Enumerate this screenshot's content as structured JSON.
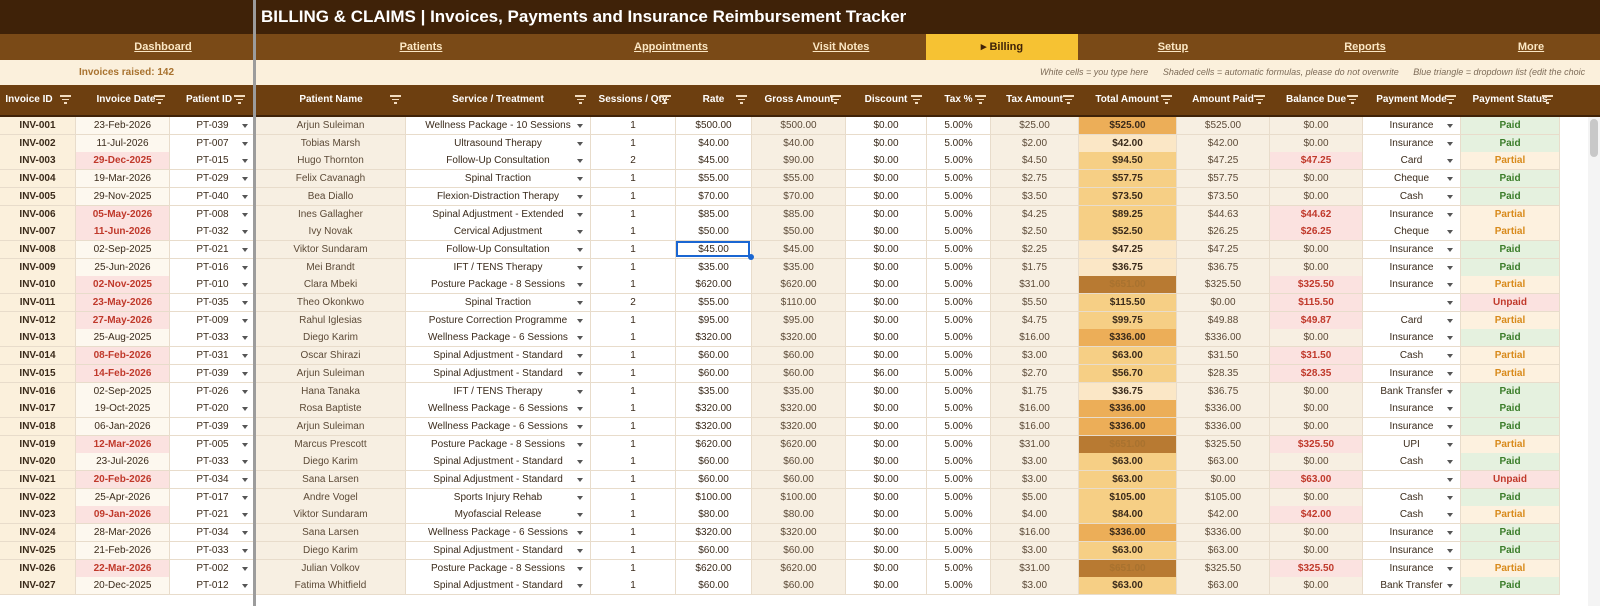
{
  "app": {
    "title": "BILLING & CLAIMS  |  Invoices, Payments and Insurance Reimbursement Tracker"
  },
  "nav": [
    {
      "label": "Dashboard"
    },
    {
      "label": "Patients"
    },
    {
      "label": "Appointments"
    },
    {
      "label": "Visit Notes"
    },
    {
      "label": "▸ Billing",
      "active": true
    },
    {
      "label": "Setup"
    },
    {
      "label": "Reports"
    },
    {
      "label": "More"
    }
  ],
  "info": {
    "invoices_raised": "Invoices raised: 142",
    "legend_white": "White cells = you type here",
    "legend_shaded": "Shaded cells = automatic formulas, please do not overwrite",
    "legend_blue": "Blue triangle = dropdown list (edit the choic"
  },
  "columns": [
    "Invoice ID",
    "Invoice Date",
    "Patient ID",
    "Patient Name",
    "Service / Treatment",
    "Sessions / Qty",
    "Rate",
    "Gross Amount",
    "Discount",
    "Tax %",
    "Tax Amount",
    "Total Amount",
    "Amount Paid",
    "Balance Due",
    "Payment Mode",
    "Payment Status"
  ],
  "colors": {
    "title_bg": "#3f2208",
    "nav_bg": "#7a4a17",
    "nav_active": "#f6c233",
    "header_bg": "#6d3f10",
    "paid": "#3b7d2a",
    "partial": "#d88a1b",
    "unpaid": "#c0392b",
    "selection": "#1a66d2"
  },
  "rows": [
    [
      "INV-001",
      "23-Feb-2026",
      "PT-039",
      "Arjun Suleiman",
      "Wellness Package - 10 Sessions",
      "1",
      "$500.00",
      "$500.00",
      "$0.00",
      "5.00%",
      "$25.00",
      "$525.00",
      "$525.00",
      "$0.00",
      "Insurance",
      "Paid"
    ],
    [
      "INV-002",
      "11-Jul-2026",
      "PT-007",
      "Tobias Marsh",
      "Ultrasound Therapy",
      "1",
      "$40.00",
      "$40.00",
      "$0.00",
      "5.00%",
      "$2.00",
      "$42.00",
      "$42.00",
      "$0.00",
      "Insurance",
      "Paid"
    ],
    [
      "INV-003",
      "29-Dec-2025",
      "PT-015",
      "Hugo Thornton",
      "Follow-Up Consultation",
      "2",
      "$45.00",
      "$90.00",
      "$0.00",
      "5.00%",
      "$4.50",
      "$94.50",
      "$47.25",
      "$47.25",
      "Card",
      "Partial"
    ],
    [
      "INV-004",
      "19-Mar-2026",
      "PT-029",
      "Felix Cavanagh",
      "Spinal Traction",
      "1",
      "$55.00",
      "$55.00",
      "$0.00",
      "5.00%",
      "$2.75",
      "$57.75",
      "$57.75",
      "$0.00",
      "Cheque",
      "Paid"
    ],
    [
      "INV-005",
      "29-Nov-2025",
      "PT-040",
      "Bea Diallo",
      "Flexion-Distraction Therapy",
      "1",
      "$70.00",
      "$70.00",
      "$0.00",
      "5.00%",
      "$3.50",
      "$73.50",
      "$73.50",
      "$0.00",
      "Cash",
      "Paid"
    ],
    [
      "INV-006",
      "05-May-2026",
      "PT-008",
      "Ines Gallagher",
      "Spinal Adjustment - Extended",
      "1",
      "$85.00",
      "$85.00",
      "$0.00",
      "5.00%",
      "$4.25",
      "$89.25",
      "$44.63",
      "$44.62",
      "Insurance",
      "Partial"
    ],
    [
      "INV-007",
      "11-Jun-2026",
      "PT-032",
      "Ivy Novak",
      "Cervical Adjustment",
      "1",
      "$50.00",
      "$50.00",
      "$0.00",
      "5.00%",
      "$2.50",
      "$52.50",
      "$26.25",
      "$26.25",
      "Cheque",
      "Partial"
    ],
    [
      "INV-008",
      "02-Sep-2025",
      "PT-021",
      "Viktor Sundaram",
      "Follow-Up Consultation",
      "1",
      "$45.00",
      "$45.00",
      "$0.00",
      "5.00%",
      "$2.25",
      "$47.25",
      "$47.25",
      "$0.00",
      "Insurance",
      "Paid"
    ],
    [
      "INV-009",
      "25-Jun-2026",
      "PT-016",
      "Mei Brandt",
      "IFT / TENS Therapy",
      "1",
      "$35.00",
      "$35.00",
      "$0.00",
      "5.00%",
      "$1.75",
      "$36.75",
      "$36.75",
      "$0.00",
      "Insurance",
      "Paid"
    ],
    [
      "INV-010",
      "02-Nov-2025",
      "PT-010",
      "Clara Mbeki",
      "Posture Package - 8 Sessions",
      "1",
      "$620.00",
      "$620.00",
      "$0.00",
      "5.00%",
      "$31.00",
      "$651.00",
      "$325.50",
      "$325.50",
      "Insurance",
      "Partial"
    ],
    [
      "INV-011",
      "23-May-2026",
      "PT-035",
      "Theo Okonkwo",
      "Spinal Traction",
      "2",
      "$55.00",
      "$110.00",
      "$0.00",
      "5.00%",
      "$5.50",
      "$115.50",
      "$0.00",
      "$115.50",
      "",
      "Unpaid"
    ],
    [
      "INV-012",
      "27-May-2026",
      "PT-009",
      "Rahul Iglesias",
      "Posture Correction Programme",
      "1",
      "$95.00",
      "$95.00",
      "$0.00",
      "5.00%",
      "$4.75",
      "$99.75",
      "$49.88",
      "$49.87",
      "Card",
      "Partial"
    ],
    [
      "INV-013",
      "25-Aug-2025",
      "PT-033",
      "Diego Karim",
      "Wellness Package - 6 Sessions",
      "1",
      "$320.00",
      "$320.00",
      "$0.00",
      "5.00%",
      "$16.00",
      "$336.00",
      "$336.00",
      "$0.00",
      "Insurance",
      "Paid"
    ],
    [
      "INV-014",
      "08-Feb-2026",
      "PT-031",
      "Oscar Shirazi",
      "Spinal Adjustment - Standard",
      "1",
      "$60.00",
      "$60.00",
      "$0.00",
      "5.00%",
      "$3.00",
      "$63.00",
      "$31.50",
      "$31.50",
      "Cash",
      "Partial"
    ],
    [
      "INV-015",
      "14-Feb-2026",
      "PT-039",
      "Arjun Suleiman",
      "Spinal Adjustment - Standard",
      "1",
      "$60.00",
      "$60.00",
      "$6.00",
      "5.00%",
      "$2.70",
      "$56.70",
      "$28.35",
      "$28.35",
      "Insurance",
      "Partial"
    ],
    [
      "INV-016",
      "02-Sep-2025",
      "PT-026",
      "Hana Tanaka",
      "IFT / TENS Therapy",
      "1",
      "$35.00",
      "$35.00",
      "$0.00",
      "5.00%",
      "$1.75",
      "$36.75",
      "$36.75",
      "$0.00",
      "Bank Transfer",
      "Paid"
    ],
    [
      "INV-017",
      "19-Oct-2025",
      "PT-020",
      "Rosa Baptiste",
      "Wellness Package - 6 Sessions",
      "1",
      "$320.00",
      "$320.00",
      "$0.00",
      "5.00%",
      "$16.00",
      "$336.00",
      "$336.00",
      "$0.00",
      "Insurance",
      "Paid"
    ],
    [
      "INV-018",
      "06-Jan-2026",
      "PT-039",
      "Arjun Suleiman",
      "Wellness Package - 6 Sessions",
      "1",
      "$320.00",
      "$320.00",
      "$0.00",
      "5.00%",
      "$16.00",
      "$336.00",
      "$336.00",
      "$0.00",
      "Insurance",
      "Paid"
    ],
    [
      "INV-019",
      "12-Mar-2026",
      "PT-005",
      "Marcus Prescott",
      "Posture Package - 8 Sessions",
      "1",
      "$620.00",
      "$620.00",
      "$0.00",
      "5.00%",
      "$31.00",
      "$651.00",
      "$325.50",
      "$325.50",
      "UPI",
      "Partial"
    ],
    [
      "INV-020",
      "23-Jul-2026",
      "PT-033",
      "Diego Karim",
      "Spinal Adjustment - Standard",
      "1",
      "$60.00",
      "$60.00",
      "$0.00",
      "5.00%",
      "$3.00",
      "$63.00",
      "$63.00",
      "$0.00",
      "Cash",
      "Paid"
    ],
    [
      "INV-021",
      "20-Feb-2026",
      "PT-034",
      "Sana Larsen",
      "Spinal Adjustment - Standard",
      "1",
      "$60.00",
      "$60.00",
      "$0.00",
      "5.00%",
      "$3.00",
      "$63.00",
      "$0.00",
      "$63.00",
      "",
      "Unpaid"
    ],
    [
      "INV-022",
      "25-Apr-2026",
      "PT-017",
      "Andre Vogel",
      "Sports Injury Rehab",
      "1",
      "$100.00",
      "$100.00",
      "$0.00",
      "5.00%",
      "$5.00",
      "$105.00",
      "$105.00",
      "$0.00",
      "Cash",
      "Paid"
    ],
    [
      "INV-023",
      "09-Jan-2026",
      "PT-021",
      "Viktor Sundaram",
      "Myofascial Release",
      "1",
      "$80.00",
      "$80.00",
      "$0.00",
      "5.00%",
      "$4.00",
      "$84.00",
      "$42.00",
      "$42.00",
      "Cash",
      "Partial"
    ],
    [
      "INV-024",
      "28-Mar-2026",
      "PT-034",
      "Sana Larsen",
      "Wellness Package - 6 Sessions",
      "1",
      "$320.00",
      "$320.00",
      "$0.00",
      "5.00%",
      "$16.00",
      "$336.00",
      "$336.00",
      "$0.00",
      "Insurance",
      "Paid"
    ],
    [
      "INV-025",
      "21-Feb-2026",
      "PT-033",
      "Diego Karim",
      "Spinal Adjustment - Standard",
      "1",
      "$60.00",
      "$60.00",
      "$0.00",
      "5.00%",
      "$3.00",
      "$63.00",
      "$63.00",
      "$0.00",
      "Insurance",
      "Paid"
    ],
    [
      "INV-026",
      "22-Mar-2026",
      "PT-002",
      "Julian Volkov",
      "Posture Package - 8 Sessions",
      "1",
      "$620.00",
      "$620.00",
      "$0.00",
      "5.00%",
      "$31.00",
      "$651.00",
      "$325.50",
      "$325.50",
      "Insurance",
      "Partial"
    ],
    [
      "INV-027",
      "20-Dec-2025",
      "PT-012",
      "Fatima Whitfield",
      "Spinal Adjustment - Standard",
      "1",
      "$60.00",
      "$60.00",
      "$0.00",
      "5.00%",
      "$3.00",
      "$63.00",
      "$63.00",
      "$0.00",
      "Bank Transfer",
      "Paid"
    ]
  ],
  "overdue_dates": [
    "29-Dec-2025",
    "05-May-2026",
    "11-Jun-2026",
    "02-Nov-2025",
    "23-May-2026",
    "27-May-2026",
    "08-Feb-2026",
    "14-Feb-2026",
    "12-Mar-2026",
    "20-Feb-2026",
    "09-Jan-2026",
    "22-Mar-2026"
  ],
  "selected_cell": {
    "row": 7,
    "column": "Rate"
  }
}
